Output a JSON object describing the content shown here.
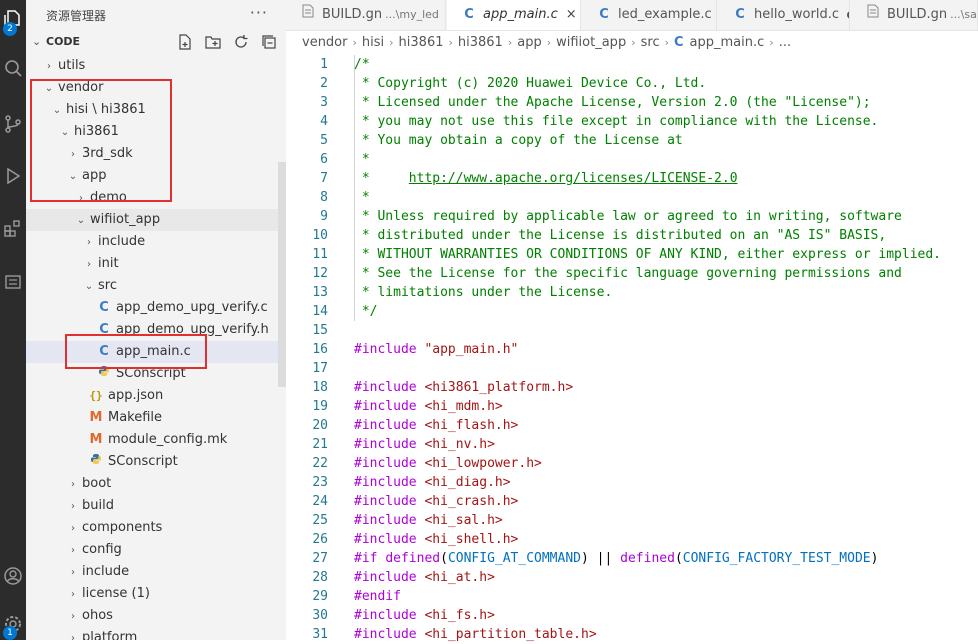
{
  "activity_bar": {
    "items": [
      {
        "icon": "explorer-icon",
        "badge": "2"
      },
      {
        "icon": "search-icon"
      },
      {
        "icon": "source-control-icon"
      },
      {
        "icon": "run-debug-icon"
      },
      {
        "icon": "extensions-icon"
      },
      {
        "icon": "remote-icon"
      },
      {
        "icon": "account-icon"
      },
      {
        "icon": "settings-gear-icon",
        "badge": "1"
      }
    ]
  },
  "sidebar": {
    "title": "资源管理器",
    "more": "···",
    "section": "CODE",
    "actions": [
      "new-file-icon",
      "new-folder-icon",
      "refresh-icon",
      "collapse-all-icon"
    ],
    "tree": [
      {
        "label": "utils",
        "twisty": "›",
        "icon": ""
      },
      {
        "label": "vendor",
        "twisty": "⌄",
        "icon": ""
      },
      {
        "label": "hisi \\ hi3861",
        "twisty": "⌄",
        "icon": ""
      },
      {
        "label": "hi3861",
        "twisty": "⌄",
        "icon": ""
      },
      {
        "label": "3rd_sdk",
        "twisty": "›",
        "icon": ""
      },
      {
        "label": "app",
        "twisty": "⌄",
        "icon": ""
      },
      {
        "label": "demo",
        "twisty": "›",
        "icon": ""
      },
      {
        "label": "wifiiot_app",
        "twisty": "⌄",
        "icon": ""
      },
      {
        "label": "include",
        "twisty": "›",
        "icon": ""
      },
      {
        "label": "init",
        "twisty": "›",
        "icon": ""
      },
      {
        "label": "src",
        "twisty": "⌄",
        "icon": ""
      },
      {
        "label": "app_demo_upg_verify.c",
        "twisty": "",
        "icon": "C"
      },
      {
        "label": "app_demo_upg_verify.h",
        "twisty": "",
        "icon": "C"
      },
      {
        "label": "app_main.c",
        "twisty": "",
        "icon": "C"
      },
      {
        "label": "SConscript",
        "twisty": "",
        "icon": "py"
      },
      {
        "label": "app.json",
        "twisty": "",
        "icon": "{}"
      },
      {
        "label": "Makefile",
        "twisty": "",
        "icon": "M"
      },
      {
        "label": "module_config.mk",
        "twisty": "",
        "icon": "M"
      },
      {
        "label": "SConscript",
        "twisty": "",
        "icon": "py"
      },
      {
        "label": "boot",
        "twisty": "›",
        "icon": ""
      },
      {
        "label": "build",
        "twisty": "›",
        "icon": ""
      },
      {
        "label": "components",
        "twisty": "›",
        "icon": ""
      },
      {
        "label": "config",
        "twisty": "›",
        "icon": ""
      },
      {
        "label": "include",
        "twisty": "›",
        "icon": ""
      },
      {
        "label": "license (1)",
        "twisty": "›",
        "icon": ""
      },
      {
        "label": "ohos",
        "twisty": "›",
        "icon": ""
      },
      {
        "label": "platform",
        "twisty": "›",
        "icon": ""
      }
    ]
  },
  "tabs": [
    {
      "name": "BUILD.gn",
      "desc": "...\\my_led",
      "icon": "gn"
    },
    {
      "name": "app_main.c",
      "desc": "",
      "icon": "C",
      "active": true,
      "close": "×"
    },
    {
      "name": "led_example.c",
      "desc": "",
      "icon": "C",
      "dirty": true
    },
    {
      "name": "hello_world.c",
      "desc": "",
      "icon": "C",
      "dirty": true
    },
    {
      "name": "BUILD.gn",
      "desc": "...\\sam",
      "icon": "gn"
    }
  ],
  "breadcrumb": [
    "vendor",
    "hisi",
    "hi3861",
    "hi3861",
    "app",
    "wifiiot_app",
    "src",
    "app_main.c",
    "..."
  ],
  "code": [
    [
      [
        "c-com",
        "/*"
      ]
    ],
    [
      [
        "c-com",
        " * Copyright (c) 2020 Huawei Device Co., Ltd."
      ]
    ],
    [
      [
        "c-com",
        " * Licensed under the Apache License, Version 2.0 (the \"License\");"
      ]
    ],
    [
      [
        "c-com",
        " * you may not use this file except in compliance with the License."
      ]
    ],
    [
      [
        "c-com",
        " * You may obtain a copy of the License at"
      ]
    ],
    [
      [
        "c-com",
        " *"
      ]
    ],
    [
      [
        "c-com",
        " *     "
      ],
      [
        "c-link",
        "http://www.apache.org/licenses/LICENSE-2.0"
      ]
    ],
    [
      [
        "c-com",
        " *"
      ]
    ],
    [
      [
        "c-com",
        " * Unless required by applicable law or agreed to in writing, software"
      ]
    ],
    [
      [
        "c-com",
        " * distributed under the License is distributed on an \"AS IS\" BASIS,"
      ]
    ],
    [
      [
        "c-com",
        " * WITHOUT WARRANTIES OR CONDITIONS OF ANY KIND, either express or implied."
      ]
    ],
    [
      [
        "c-com",
        " * See the License for the specific language governing permissions and"
      ]
    ],
    [
      [
        "c-com",
        " * limitations under the License."
      ]
    ],
    [
      [
        "c-com",
        " */"
      ]
    ],
    [],
    [
      [
        "c-kw",
        "#include "
      ],
      [
        "c-str",
        "\"app_main.h\""
      ]
    ],
    [],
    [
      [
        "c-kw",
        "#include "
      ],
      [
        "c-str",
        "<hi3861_platform.h>"
      ]
    ],
    [
      [
        "c-kw",
        "#include "
      ],
      [
        "c-str",
        "<hi_mdm.h>"
      ]
    ],
    [
      [
        "c-kw",
        "#include "
      ],
      [
        "c-str",
        "<hi_flash.h>"
      ]
    ],
    [
      [
        "c-kw",
        "#include "
      ],
      [
        "c-str",
        "<hi_nv.h>"
      ]
    ],
    [
      [
        "c-kw",
        "#include "
      ],
      [
        "c-str",
        "<hi_lowpower.h>"
      ]
    ],
    [
      [
        "c-kw",
        "#include "
      ],
      [
        "c-str",
        "<hi_diag.h>"
      ]
    ],
    [
      [
        "c-kw",
        "#include "
      ],
      [
        "c-str",
        "<hi_crash.h>"
      ]
    ],
    [
      [
        "c-kw",
        "#include "
      ],
      [
        "c-str",
        "<hi_sal.h>"
      ]
    ],
    [
      [
        "c-kw",
        "#include "
      ],
      [
        "c-str",
        "<hi_shell.h>"
      ]
    ],
    [
      [
        "c-kw",
        "#if "
      ],
      [
        "c-kw",
        "defined"
      ],
      [
        "c-op",
        "("
      ],
      [
        "c-mac",
        "CONFIG_AT_COMMAND"
      ],
      [
        "c-op",
        ") || "
      ],
      [
        "c-kw",
        "defined"
      ],
      [
        "c-op",
        "("
      ],
      [
        "c-mac",
        "CONFIG_FACTORY_TEST_MODE"
      ],
      [
        "c-op",
        ")"
      ]
    ],
    [
      [
        "c-kw",
        "#include "
      ],
      [
        "c-str",
        "<hi_at.h>"
      ]
    ],
    [
      [
        "c-kw",
        "#endif"
      ]
    ],
    [
      [
        "c-kw",
        "#include "
      ],
      [
        "c-str",
        "<hi_fs.h>"
      ]
    ],
    [
      [
        "c-kw",
        "#include "
      ],
      [
        "c-str",
        "<hi_partition_table.h>"
      ]
    ]
  ]
}
